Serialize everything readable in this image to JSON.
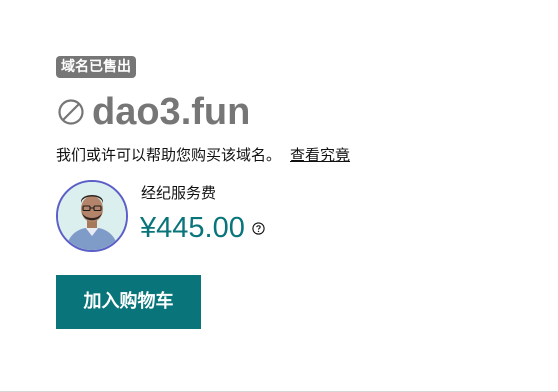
{
  "badge": {
    "label": "域名已售出"
  },
  "domain": {
    "name": "dao3.fun",
    "status_icon": "ban-icon"
  },
  "help": {
    "text": "我们或许可以帮助您购买该域名。",
    "link_label": "查看究竟"
  },
  "broker": {
    "label": "经纪服务费",
    "price": "¥445.00",
    "info_icon": "question-circle-icon"
  },
  "cart": {
    "button_label": "加入购物车"
  },
  "colors": {
    "accent": "#09757a",
    "badge_bg": "#767676",
    "domain_text": "#767676",
    "avatar_border": "#5b5fc7"
  }
}
